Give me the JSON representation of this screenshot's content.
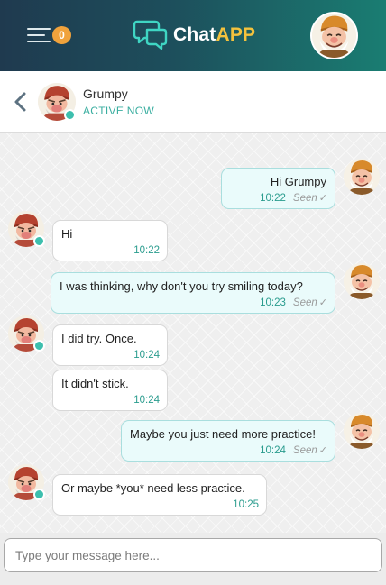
{
  "header": {
    "app_name_part1": "Chat",
    "app_name_part2": "APP",
    "notification_count": "0",
    "menu_icon": "hamburger-menu-icon",
    "logo_icon": "chat-bubbles-icon"
  },
  "contact": {
    "name": "Grumpy",
    "status": "ACTIVE NOW",
    "back_icon": "chevron-left-icon"
  },
  "messages": [
    {
      "direction": "out",
      "text": "Hi Grumpy",
      "time": "10:22",
      "seen": "Seen",
      "check": "✓"
    },
    {
      "direction": "in",
      "text": "Hi",
      "time": "10:22"
    },
    {
      "direction": "out",
      "text": "I was thinking, why don't you try smiling today?",
      "time": "10:23",
      "seen": "Seen",
      "check": "✓"
    },
    {
      "direction": "in",
      "text": "I did try. Once.",
      "time": "10:24"
    },
    {
      "direction": "in",
      "text": "It didn't stick.",
      "time": "10:24"
    },
    {
      "direction": "out",
      "text": "Maybe you just need more practice!",
      "time": "10:24",
      "seen": "Seen",
      "check": "✓"
    },
    {
      "direction": "in",
      "text": "Or maybe *you* need less practice.",
      "time": "10:25"
    }
  ],
  "composer": {
    "placeholder": "Type your message here..."
  },
  "colors": {
    "header_start": "#1f3a4f",
    "header_end": "#1a7d72",
    "accent_teal": "#2a9c8e",
    "badge_orange": "#f0a23c",
    "logo_yellow": "#f3c23d",
    "online_dot": "#3dbfae"
  }
}
